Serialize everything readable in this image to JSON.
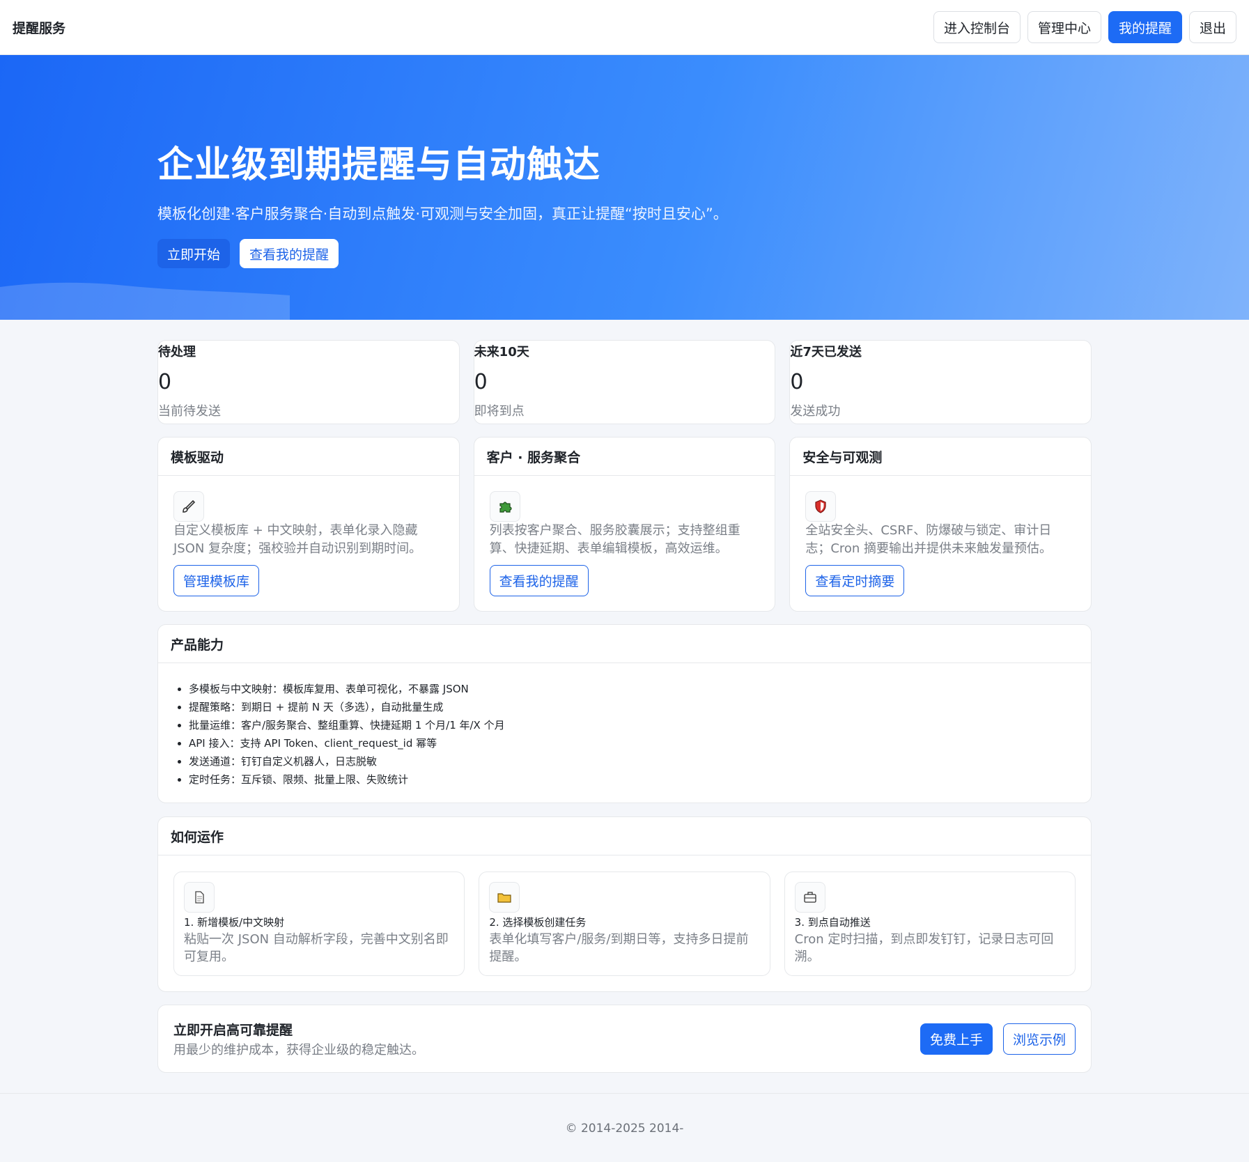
{
  "navbar": {
    "brand": "提醒服务",
    "buttons": [
      {
        "label": "进入控制台"
      },
      {
        "label": "管理中心"
      },
      {
        "label": "我的提醒"
      },
      {
        "label": "退出"
      }
    ]
  },
  "hero": {
    "title": "企业级到期提醒与自动触达",
    "subtitle": "模板化创建·客户服务聚合·自动到点触发·可观测与安全加固，真正让提醒“按时且安心”。",
    "start_label": "立即开始",
    "view_label": "查看我的提醒"
  },
  "stats": [
    {
      "label": "待处理",
      "value": "0",
      "sub": "当前待发送"
    },
    {
      "label": "未来10天",
      "value": "0",
      "sub": "即将到点"
    },
    {
      "label": "近7天已发送",
      "value": "0",
      "sub": "发送成功"
    }
  ],
  "features": [
    {
      "title": "模板驱动",
      "icon": "brush-icon",
      "text": "自定义模板库 + 中文映射，表单化录入隐藏 JSON 复杂度；强校验并自动识别到期时间。",
      "button": "管理模板库"
    },
    {
      "title": "客户 · 服务聚合",
      "icon": "puzzle-icon",
      "text": "列表按客户聚合、服务胶囊展示；支持整组重算、快捷延期、表单编辑模板，高效运维。",
      "button": "查看我的提醒"
    },
    {
      "title": "安全与可观测",
      "icon": "shield-icon",
      "text": "全站安全头、CSRF、防爆破与锁定、审计日志；Cron 摘要输出并提供未来触发量预估。",
      "button": "查看定时摘要"
    }
  ],
  "capabilities": {
    "title": "产品能力",
    "items": [
      "多模板与中文映射：模板库复用、表单可视化，不暴露 JSON",
      "提醒策略：到期日 + 提前 N 天（多选），自动批量生成",
      "批量运维：客户/服务聚合、整组重算、快捷延期 1 个月/1 年/X 个月",
      "API 接入：支持 API Token、client_request_id 幂等",
      "发送通道：钉钉自定义机器人，日志脱敏",
      "定时任务：互斥锁、限频、批量上限、失败统计"
    ]
  },
  "how": {
    "title": "如何运作",
    "steps": [
      {
        "icon": "document-icon",
        "title": "1. 新增模板/中文映射",
        "text": "粘贴一次 JSON 自动解析字段，完善中文别名即可复用。"
      },
      {
        "icon": "folder-icon",
        "title": "2. 选择模板创建任务",
        "text": "表单化填写客户/服务/到期日等，支持多日提前提醒。"
      },
      {
        "icon": "robot-icon",
        "title": "3. 到点自动推送",
        "text": "Cron 定时扫描，到点即发钉钉，记录日志可回溯。"
      }
    ]
  },
  "cta": {
    "title": "立即开启高可靠提醒",
    "subtitle": "用最少的维护成本，获得企业级的稳定触达。",
    "primary": "免费上手",
    "secondary": "浏览示例"
  },
  "footer": {
    "text": "© 2014-2025 2014-"
  },
  "colors": {
    "accent": "#1d6bf5",
    "hero_start": "#1b67f6",
    "hero_end": "#7fb3fb"
  }
}
